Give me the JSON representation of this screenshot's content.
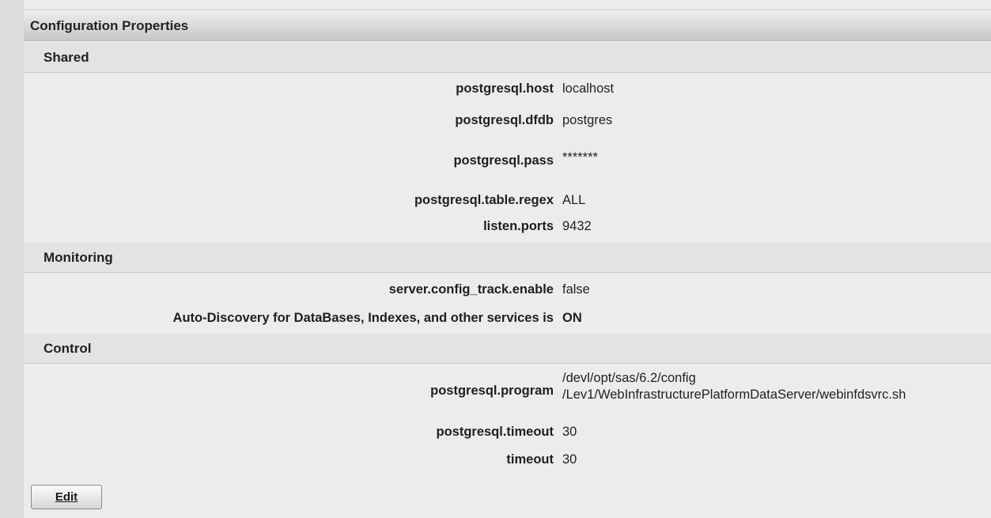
{
  "panel": {
    "title": "Configuration Properties"
  },
  "sections": {
    "shared": {
      "title": "Shared",
      "rows": [
        {
          "key": "postgresql.host",
          "value": "localhost"
        },
        {
          "key": "postgresql.dfdb",
          "value": "postgres"
        },
        {
          "key": "postgresql.pass",
          "value": "*******"
        },
        {
          "key": "postgresql.table.regex",
          "value": "ALL"
        },
        {
          "key": "listen.ports",
          "value": "9432"
        }
      ]
    },
    "monitoring": {
      "title": "Monitoring",
      "rows": [
        {
          "key": "server.config_track.enable",
          "value": "false"
        },
        {
          "key": "Auto-Discovery for DataBases, Indexes, and other services is",
          "value": "ON"
        }
      ]
    },
    "control": {
      "title": "Control",
      "rows": [
        {
          "key": "postgresql.program",
          "value_line1": "/devl/opt/sas/6.2/config",
          "value_line2": "/Lev1/WebInfrastructurePlatformDataServer/webinfdsvrc.sh"
        },
        {
          "key": "postgresql.timeout",
          "value": "30"
        },
        {
          "key": "timeout",
          "value": "30"
        }
      ]
    }
  },
  "actions": {
    "edit_label": "Edit"
  }
}
